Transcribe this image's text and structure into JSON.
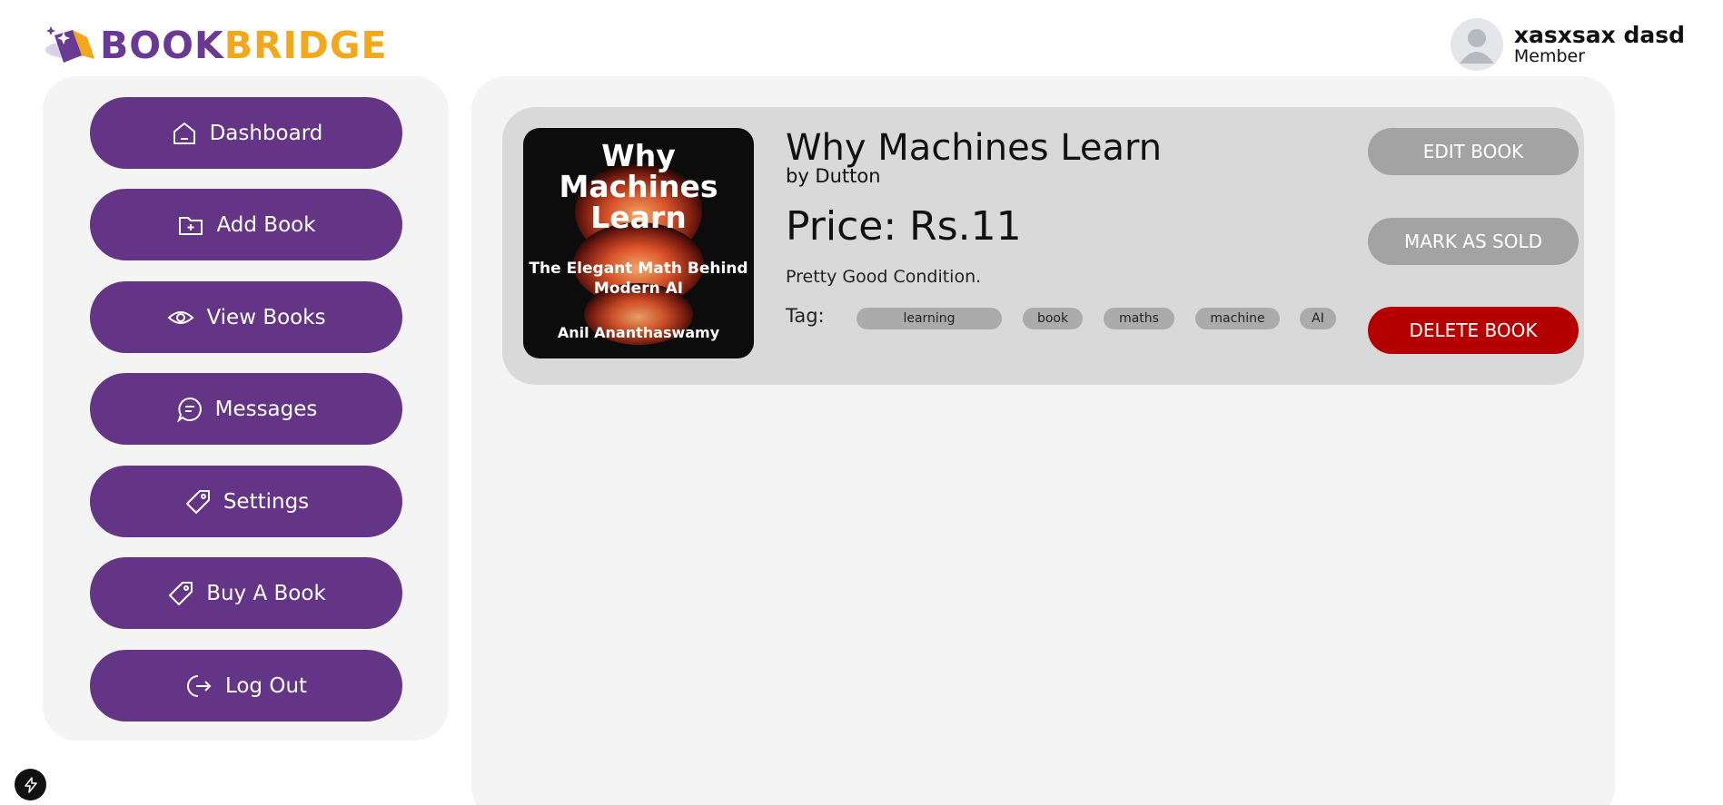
{
  "header": {
    "brand_part1": "BOOK",
    "brand_part2": "BRIDGE",
    "user_name": "xasxsax dasd",
    "user_role": "Member"
  },
  "sidebar": {
    "items": [
      {
        "label": "Dashboard",
        "icon": "home-icon"
      },
      {
        "label": "Add Book",
        "icon": "folder-plus-icon"
      },
      {
        "label": "View Books",
        "icon": "eye-icon"
      },
      {
        "label": "Messages",
        "icon": "chat-icon"
      },
      {
        "label": "Settings",
        "icon": "tag-icon"
      },
      {
        "label": "Buy A Book",
        "icon": "tag-icon"
      },
      {
        "label": "Log Out",
        "icon": "logout-icon"
      }
    ]
  },
  "book": {
    "cover_title": "Why Machines Learn",
    "cover_subtitle": "The Elegant Math Behind Modern AI",
    "cover_author": "Anil Ananthaswamy",
    "title": "Why Machines Learn",
    "author": "by Dutton",
    "price": "Price: Rs.11",
    "condition": "Pretty Good Condition.",
    "tag_label": "Tag:",
    "tags": [
      "learning",
      "book",
      "maths",
      "machine",
      "AI"
    ],
    "actions": {
      "edit": "EDIT BOOK",
      "sold": "MARK AS SOLD",
      "delete": "DELETE BOOK"
    }
  },
  "colors": {
    "brand_purple": "#643586",
    "brand_yellow": "#f2a81d",
    "danger_red": "#b50000",
    "muted_grey": "#a3a3a3"
  }
}
